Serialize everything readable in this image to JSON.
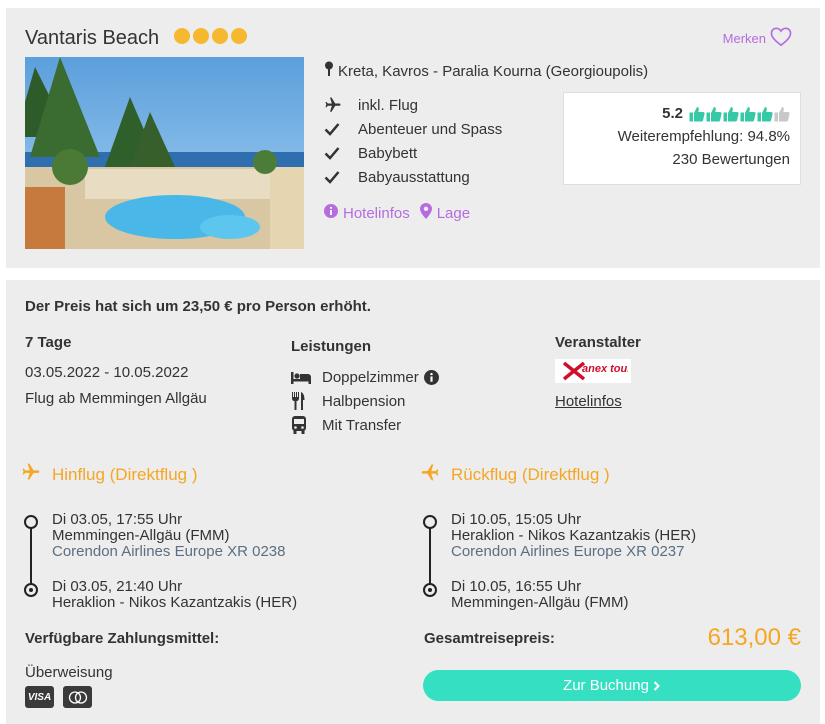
{
  "hotel": {
    "name": "Vantaris Beach",
    "star_count": 4,
    "star_color": "#f5b82e",
    "save_label": "Merken",
    "location": "Kreta, Kavros - Paralia Kourna (Georgioupolis)",
    "features": [
      {
        "icon": "plane-icon",
        "label": "inkl. Flug"
      },
      {
        "icon": "check-icon",
        "label": "Abenteuer und Spass"
      },
      {
        "icon": "check-icon",
        "label": "Babybett"
      },
      {
        "icon": "check-icon",
        "label": "Babyausstattung"
      }
    ],
    "links": {
      "info": "Hotelinfos",
      "map": "Lage"
    },
    "rating": {
      "score": "5.2",
      "thumbs_total": 6,
      "thumbs_filled": 5,
      "recommendation": "Weiterempfehlung: 94.8%",
      "reviews": "230 Bewertungen"
    }
  },
  "booking": {
    "price_note": "Der Preis hat sich um 23,50 € pro Person erhöht.",
    "duration": "7 Tage",
    "dates": "03.05.2022 - 10.05.2022",
    "departure": "Flug ab Memmingen Allgäu",
    "services_heading": "Leistungen",
    "services": [
      {
        "icon": "bed-icon",
        "label": "Doppelzimmer"
      },
      {
        "icon": "cutlery-icon",
        "label": "Halbpension"
      },
      {
        "icon": "bus-icon",
        "label": "Mit Transfer"
      }
    ],
    "operator_heading": "Veranstalter",
    "operator_logo_text": "anex tour",
    "operator_link": "Hotelinfos",
    "outbound": {
      "title": "Hinflug (Direktflug )",
      "dep_time": "Di 03.05, 17:55 Uhr",
      "dep_airport": "Memmingen-Allgäu (FMM)",
      "airline": "Corendon Airlines Europe XR 0238",
      "arr_time": "Di 03.05, 21:40 Uhr",
      "arr_airport": "Heraklion - Nikos Kazantzakis (HER)"
    },
    "inbound": {
      "title": "Rückflug (Direktflug )",
      "dep_time": "Di 10.05, 15:05 Uhr",
      "dep_airport": "Heraklion - Nikos Kazantzakis (HER)",
      "airline": "Corendon Airlines Europe XR 0237",
      "arr_time": "Di 10.05, 16:55 Uhr",
      "arr_airport": "Memmingen-Allgäu (FMM)"
    },
    "payment_heading": "Verfügbare Zahlungsmittel:",
    "payment_method": "Überweisung",
    "card_visa": "VISA",
    "total_label": "Gesamtreisepreis:",
    "total_price": "613,00 €",
    "book_button": "Zur Buchung"
  },
  "colors": {
    "accent_purple": "#b56ce0",
    "accent_orange": "#f5a623",
    "button_teal": "#35e0c2",
    "thumb_green": "#36c9a8"
  }
}
